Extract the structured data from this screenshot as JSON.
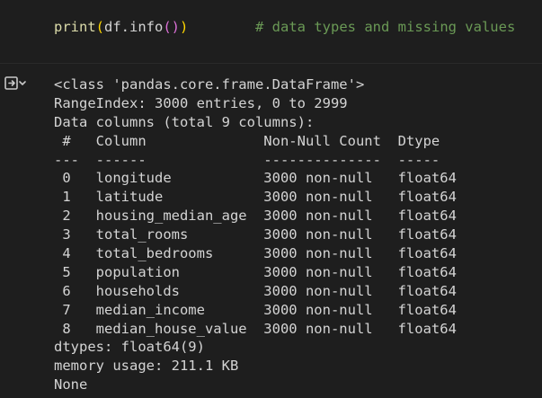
{
  "code_cell": {
    "fn_name": "print",
    "open_paren": "(",
    "arg_pre": "df.info",
    "inner_parens": "()",
    "close_paren": ")",
    "comment": "# data types and missing values"
  },
  "output_icon": "output-arrow-icon",
  "output": {
    "lines": [
      "<class 'pandas.core.frame.DataFrame'>",
      "RangeIndex: 3000 entries, 0 to 2999",
      "Data columns (total 9 columns):",
      " #   Column              Non-Null Count  Dtype  ",
      "---  ------              --------------  -----  ",
      " 0   longitude           3000 non-null   float64",
      " 1   latitude            3000 non-null   float64",
      " 2   housing_median_age  3000 non-null   float64",
      " 3   total_rooms         3000 non-null   float64",
      " 4   total_bedrooms      3000 non-null   float64",
      " 5   population          3000 non-null   float64",
      " 6   households          3000 non-null   float64",
      " 7   median_income       3000 non-null   float64",
      " 8   median_house_value  3000 non-null   float64",
      "dtypes: float64(9)",
      "memory usage: 211.1 KB",
      "None"
    ]
  },
  "colors": {
    "background": "#1e1e1e",
    "text": "#d4d4d4",
    "function": "#dcdcaa",
    "paren_outer": "#ffd700",
    "paren_inner": "#da70d6",
    "comment": "#6a9955"
  }
}
